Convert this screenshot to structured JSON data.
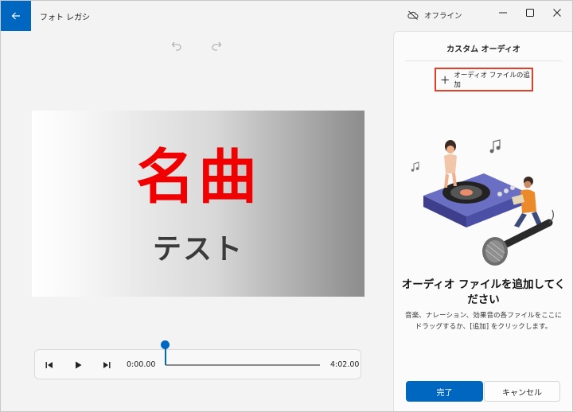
{
  "app": {
    "title": "フォト レガシ",
    "status": "オフライン"
  },
  "icons": {
    "back": "arrow-left-icon",
    "offline": "cloud-off-icon",
    "minimize": "minimize-icon",
    "maximize": "maximize-icon",
    "close": "close-icon",
    "undo": "undo-icon",
    "redo": "redo-icon",
    "add": "plus-icon"
  },
  "preview": {
    "title_text": "名曲",
    "subtitle_text": "テスト",
    "title_color": "#f00000"
  },
  "player": {
    "current_time": "0:00.00",
    "total_time": "4:02.00",
    "progress": 0.0
  },
  "panel": {
    "title": "カスタム オーディオ",
    "add_button": "オーディオ ファイルの追加",
    "empty_heading": "オーディオ ファイルを追加してください",
    "empty_description": "音楽、ナレーション、効果音の各ファイルをここにドラッグするか、[追加] をクリックします。",
    "done_button": "完了",
    "cancel_button": "キャンセル"
  },
  "colors": {
    "accent": "#0067c0",
    "highlight_border": "#e0402a"
  }
}
